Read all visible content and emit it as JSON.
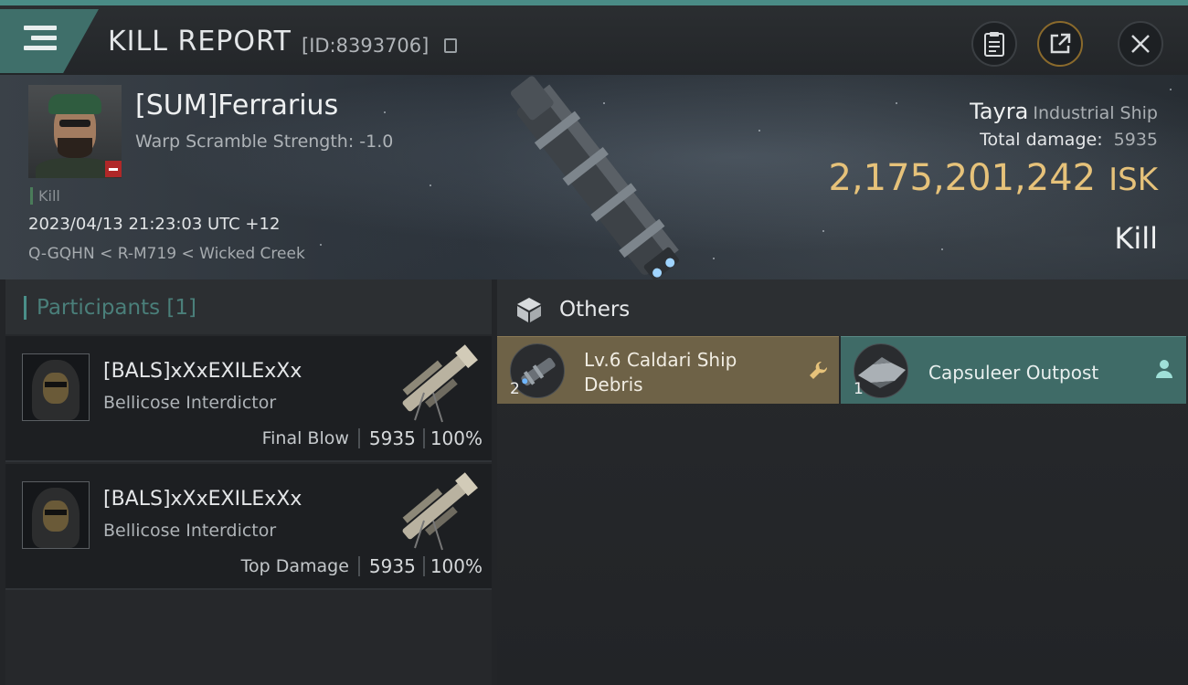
{
  "header": {
    "title": "KILL REPORT",
    "report_id": "[ID:8393706]",
    "icons": [
      "menu-icon",
      "copy-icon",
      "clipboard-icon",
      "share-icon",
      "close-icon"
    ]
  },
  "victim": {
    "name": "[SUM]Ferrarius",
    "warp_scramble": "Warp Scramble Strength: -1.0",
    "kill_label": "Kill",
    "datetime": "2023/04/13 21:23:03 UTC +12",
    "location": "Q-GQHN < R-M719 < Wicked Creek",
    "ship_name": "Tayra",
    "ship_class": "Industrial Ship",
    "total_damage_label": "Total damage:",
    "total_damage": "5935",
    "isk_value": "2,175,201,242",
    "isk_unit": "ISK",
    "result": "Kill"
  },
  "participants": {
    "title": "Participants",
    "count": "[1]",
    "rows": [
      {
        "name": "[BALS]xXxEXILExXx",
        "ship": "Bellicose Interdictor",
        "label": "Final Blow",
        "damage": "5935",
        "percent": "100%"
      },
      {
        "name": "[BALS]xXxEXILExXx",
        "ship": "Bellicose Interdictor",
        "label": "Top Damage",
        "damage": "5935",
        "percent": "100%"
      }
    ]
  },
  "others": {
    "title": "Others",
    "items": [
      {
        "name": "Lv.6 Caldari Ship Debris",
        "qty": "2",
        "icon": "wrench-icon",
        "color": "#6e6247"
      },
      {
        "name": "Capsuleer Outpost",
        "qty": "1",
        "icon": "person-icon",
        "color": "#3f6b67"
      }
    ]
  },
  "colors": {
    "accent": "#4a8c86",
    "isk": "#e6c27a",
    "debris_card": "#6e6247",
    "outpost_card": "#3f6b67"
  }
}
